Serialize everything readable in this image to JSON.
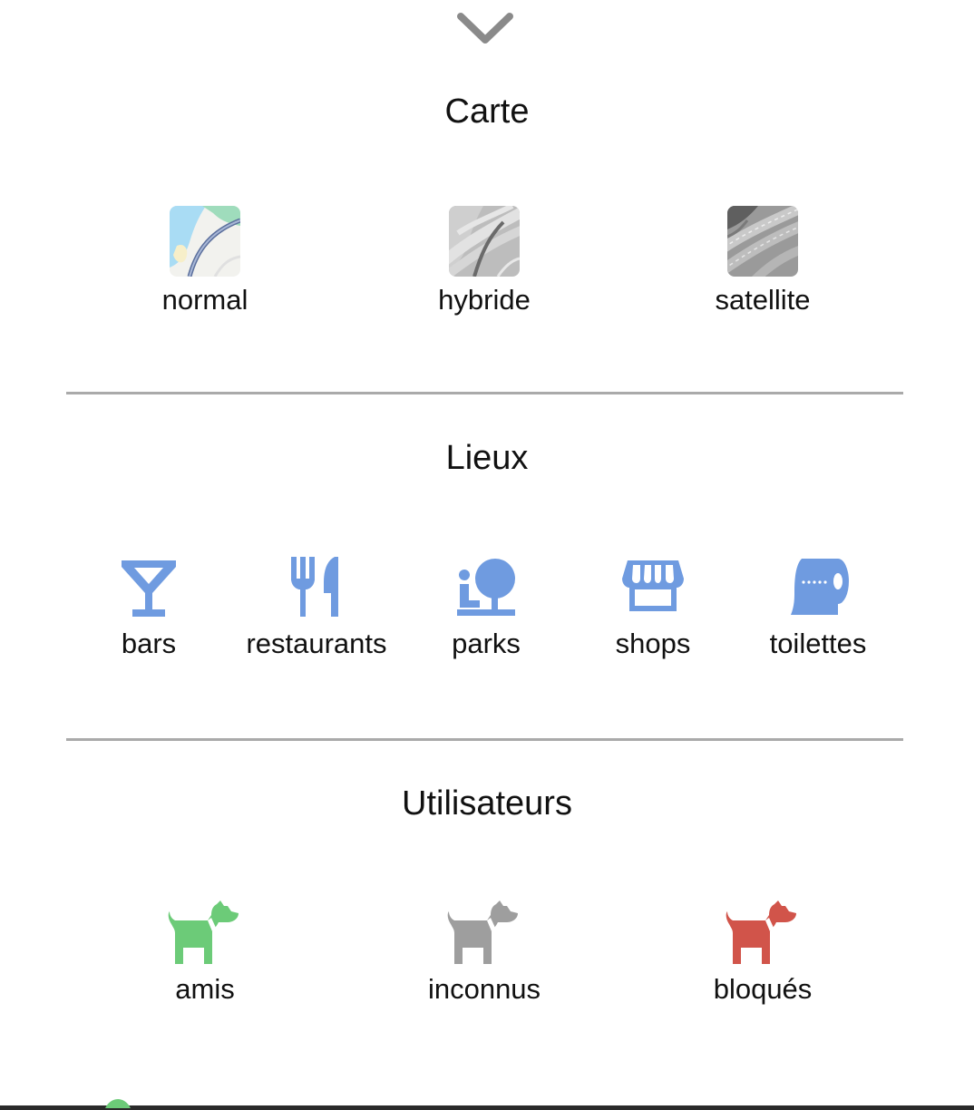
{
  "handle": {
    "icon": "chevron-down-icon"
  },
  "sections": {
    "map": {
      "title": "Carte",
      "options": [
        {
          "label": "normal",
          "icon": "map-normal-thumbnail"
        },
        {
          "label": "hybride",
          "icon": "map-hybrid-thumbnail"
        },
        {
          "label": "satellite",
          "icon": "map-satellite-thumbnail"
        }
      ]
    },
    "places": {
      "title": "Lieux",
      "accent_color": "#6f9be0",
      "options": [
        {
          "label": "bars",
          "icon": "cocktail-glass-icon"
        },
        {
          "label": "restaurants",
          "icon": "fork-knife-icon"
        },
        {
          "label": "parks",
          "icon": "park-tree-icon"
        },
        {
          "label": "shops",
          "icon": "storefront-icon"
        },
        {
          "label": "toilettes",
          "icon": "toilet-paper-icon"
        }
      ]
    },
    "users": {
      "title": "Utilisateurs",
      "options": [
        {
          "label": "amis",
          "icon": "dog-icon",
          "color": "#6ccb78"
        },
        {
          "label": "inconnus",
          "icon": "dog-icon",
          "color": "#9e9e9e"
        },
        {
          "label": "bloqués",
          "icon": "dog-icon",
          "color": "#d1544a"
        }
      ]
    }
  }
}
